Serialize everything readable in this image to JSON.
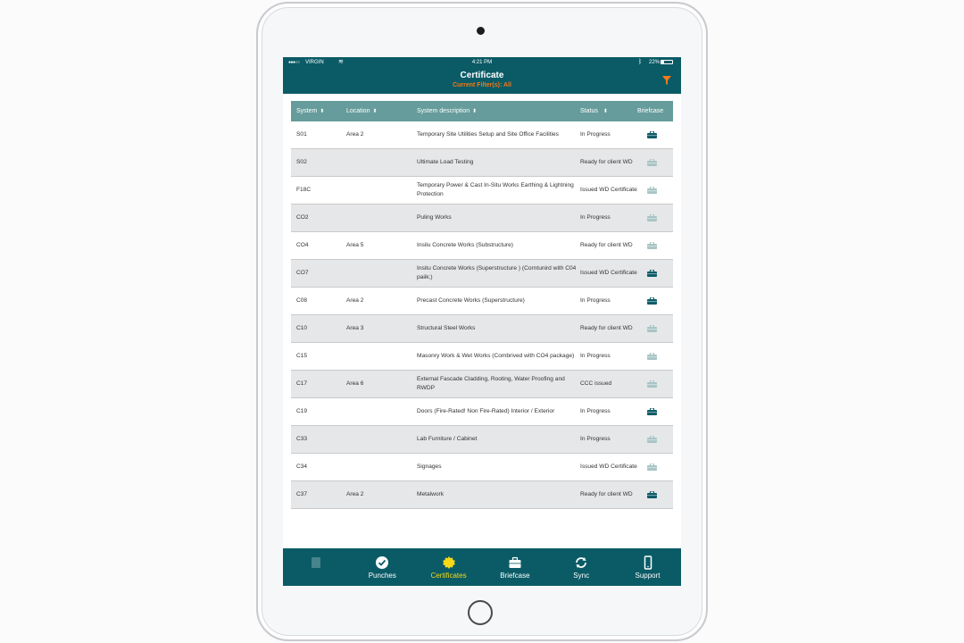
{
  "statusbar": {
    "carrier": "VIRGIN",
    "time": "4:21 PM",
    "battery": "22%"
  },
  "header": {
    "title": "Certificate",
    "filter_text": "Current Filter(s): All"
  },
  "colors": {
    "primary": "#0a5b66",
    "table_header": "#669c9b",
    "accent_orange": "#f27a1a",
    "active_tab": "#f7d917",
    "briefcase_active": "#0a5b66",
    "briefcase_inactive": "#a8c4c4"
  },
  "table": {
    "columns": {
      "system": "System",
      "location": "Location",
      "description": "System description",
      "status": "Status",
      "briefcase": "Briefcase"
    },
    "rows": [
      {
        "system": "S01",
        "location": "Area 2",
        "description": "Temporary Site Utilities Setup and Site Office Facilities",
        "status": "In Progress",
        "briefcase": true
      },
      {
        "system": "S02",
        "location": "",
        "description": "Ultimate Load Testing",
        "status": "Ready for client WD",
        "briefcase": false
      },
      {
        "system": "F18C",
        "location": "",
        "description": "Temporary Power & Cast In-Situ Works Earthing & Lightning Protection",
        "status": "Issued WD Certificate",
        "briefcase": false
      },
      {
        "system": "CO2",
        "location": "",
        "description": "Puling Works",
        "status": "In Progress",
        "briefcase": false
      },
      {
        "system": "CO4",
        "location": "Area 5",
        "description": "Insilu Concrete Works (Substructure)",
        "status": "Ready for client WD",
        "briefcase": false
      },
      {
        "system": "CO7",
        "location": "",
        "description": "Insitu Concrete Works (Superstructure ) (Corntunird with C04 paiik;)",
        "status": "Issued WD Certificate",
        "briefcase": true
      },
      {
        "system": "C08",
        "location": "Area 2",
        "description": "Precast Concrete Works (Superstructure)",
        "status": "In Progress",
        "briefcase": true
      },
      {
        "system": "C10",
        "location": "Area 3",
        "description": "Structural Steel Works",
        "status": "Ready for client WD",
        "briefcase": false
      },
      {
        "system": "C15",
        "location": "",
        "description": "Masonry Work & Wet Works (Combrived with CO4 package)",
        "status": "In Progress",
        "briefcase": false
      },
      {
        "system": "C17",
        "location": "Area 6",
        "description": "External Fascade Cladding, Rooting, Water Proofing and RWDP",
        "status": "CCC issued",
        "briefcase": false
      },
      {
        "system": "C19",
        "location": "",
        "description": "Doors (Fire-Rated! Non Fire-Rated) Interior / Exterior",
        "status": "In Progress",
        "briefcase": true
      },
      {
        "system": "C33",
        "location": "",
        "description": "Lab Furniture / Cabinet",
        "status": "In Progress",
        "briefcase": false
      },
      {
        "system": "C34",
        "location": "",
        "description": "Signages",
        "status": "Issued WD Certificate",
        "briefcase": false
      },
      {
        "system": "C37",
        "location": "Area 2",
        "description": "Metalwork",
        "status": "Ready for client WD",
        "briefcase": true
      }
    ]
  },
  "tabs": [
    {
      "name": "tab-first",
      "label": "",
      "icon": "document-icon",
      "state": "faded"
    },
    {
      "name": "tab-punches",
      "label": "Punches",
      "icon": "check-circle-icon",
      "state": "normal"
    },
    {
      "name": "tab-certificates",
      "label": "Certificates",
      "icon": "certificate-seal-icon",
      "state": "active"
    },
    {
      "name": "tab-briefcase",
      "label": "Briefcase",
      "icon": "briefcase-icon",
      "state": "normal"
    },
    {
      "name": "tab-sync",
      "label": "Sync",
      "icon": "sync-icon",
      "state": "normal"
    },
    {
      "name": "tab-support",
      "label": "Support",
      "icon": "phone-icon",
      "state": "normal"
    }
  ]
}
